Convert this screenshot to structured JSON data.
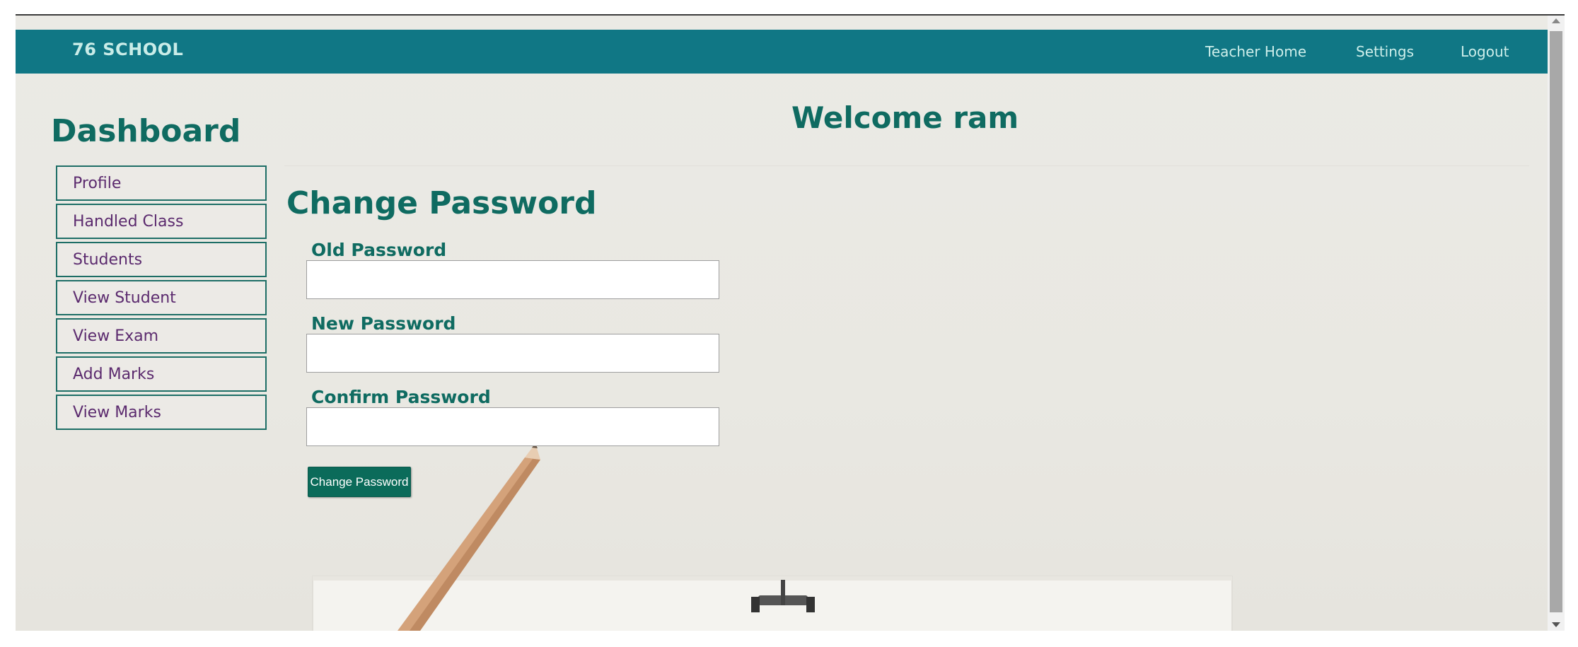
{
  "navbar": {
    "brand": "76 SCHOOL",
    "links": [
      "Teacher Home",
      "Settings",
      "Logout"
    ]
  },
  "sidebar": {
    "title": "Dashboard",
    "items": [
      "Profile",
      "Handled Class",
      "Students",
      "View Student",
      "View Exam",
      "Add Marks",
      "View Marks"
    ]
  },
  "welcome": "Welcome ram",
  "form": {
    "title": "Change Password",
    "fields": [
      {
        "label": "Old Password",
        "value": ""
      },
      {
        "label": "New Password",
        "value": ""
      },
      {
        "label": "Confirm Password",
        "value": ""
      }
    ],
    "submit_label": "Change Password"
  },
  "colors": {
    "navbar": "#107785",
    "heading": "#0f6b61",
    "sidebar_text": "#5b2a6e",
    "button": "#0b6b5a"
  },
  "icons": {
    "scroll_up": "scroll-up-arrow-icon",
    "scroll_down": "scroll-down-arrow-icon"
  }
}
